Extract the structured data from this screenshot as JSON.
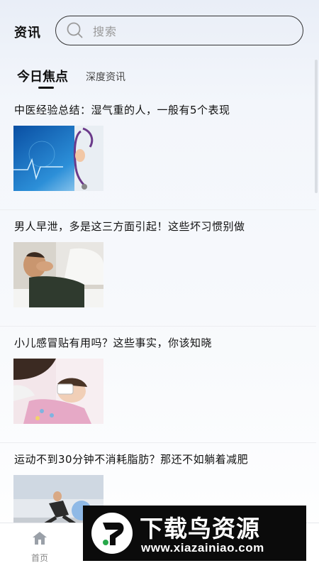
{
  "header": {
    "title": "资讯",
    "search_placeholder": "搜索"
  },
  "tabs": [
    {
      "label": "今日焦点",
      "active": true
    },
    {
      "label": "深度资讯",
      "active": false
    }
  ],
  "news": [
    {
      "title": "中医经验总结：湿气重的人，一般有5个表现",
      "image": "medical-stethoscope"
    },
    {
      "title": "男人早泄，多是这三方面引起！这些坏习惯别做",
      "image": "man-in-bed"
    },
    {
      "title": "小儿感冒贴有用吗？这些事实，你该知晓",
      "image": "child-thermometer"
    },
    {
      "title": "运动不到30分钟不消耗脂肪？那还不如躺着减肥",
      "image": "gym-workout"
    }
  ],
  "bottom_nav": [
    {
      "label": "首页",
      "icon": "home-icon"
    }
  ],
  "watermark": {
    "title": "下载鸟资源",
    "url": "www.xiazainiao.com"
  },
  "colors": {
    "accent": "#111111",
    "muted": "#999999",
    "divider": "#ecedf0"
  }
}
